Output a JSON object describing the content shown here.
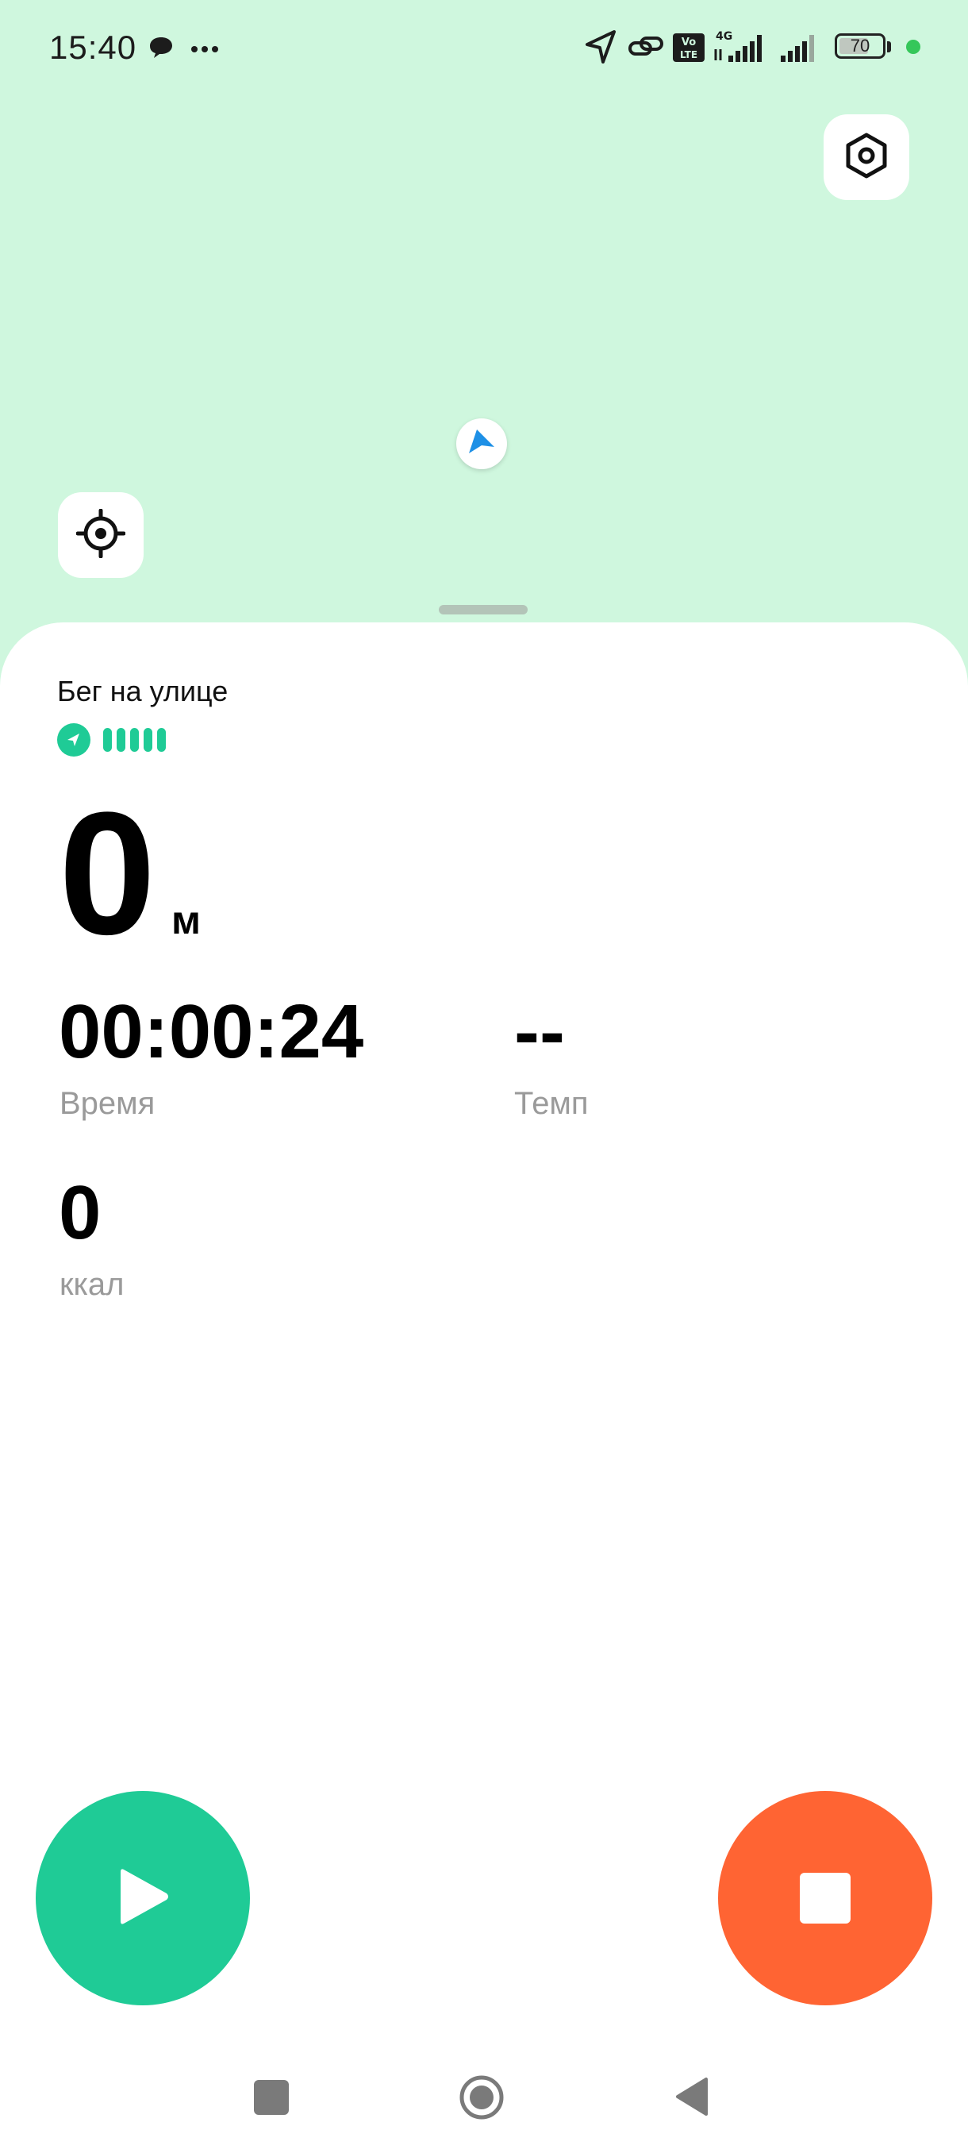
{
  "status_bar": {
    "time": "15:40",
    "battery": "70",
    "battery_level_percent": 70,
    "network": "4G",
    "volte": "Vo LTE",
    "dot_color": "#35c75a",
    "icons": [
      "chat-bubble-icon",
      "more-dots-icon",
      "location-arrow-icon",
      "link-icon",
      "volte-icon",
      "signal-icon",
      "signal-icon",
      "battery-icon"
    ]
  },
  "map": {
    "background": "#cff7de",
    "settings_icon": "hexagon-settings-icon",
    "locate_icon": "crosshair-icon",
    "marker_icon": "navigation-arrow-icon",
    "marker_color": "#1e90e6"
  },
  "workout": {
    "title": "Бег на улице",
    "gps_signal_bars": 5,
    "gps_color": "#1fcb96",
    "distance_value": "0",
    "distance_unit": "м",
    "time_value": "00:00:24",
    "time_label": "Время",
    "pace_value": "--",
    "pace_label": "Темп",
    "calories_value": "0",
    "calories_label": "ккал"
  },
  "controls": {
    "play_color": "#1fcb96",
    "stop_color": "#ff6433"
  },
  "navigation_bar": {
    "icons": [
      "recents-square-icon",
      "home-circle-icon",
      "back-triangle-icon"
    ]
  }
}
